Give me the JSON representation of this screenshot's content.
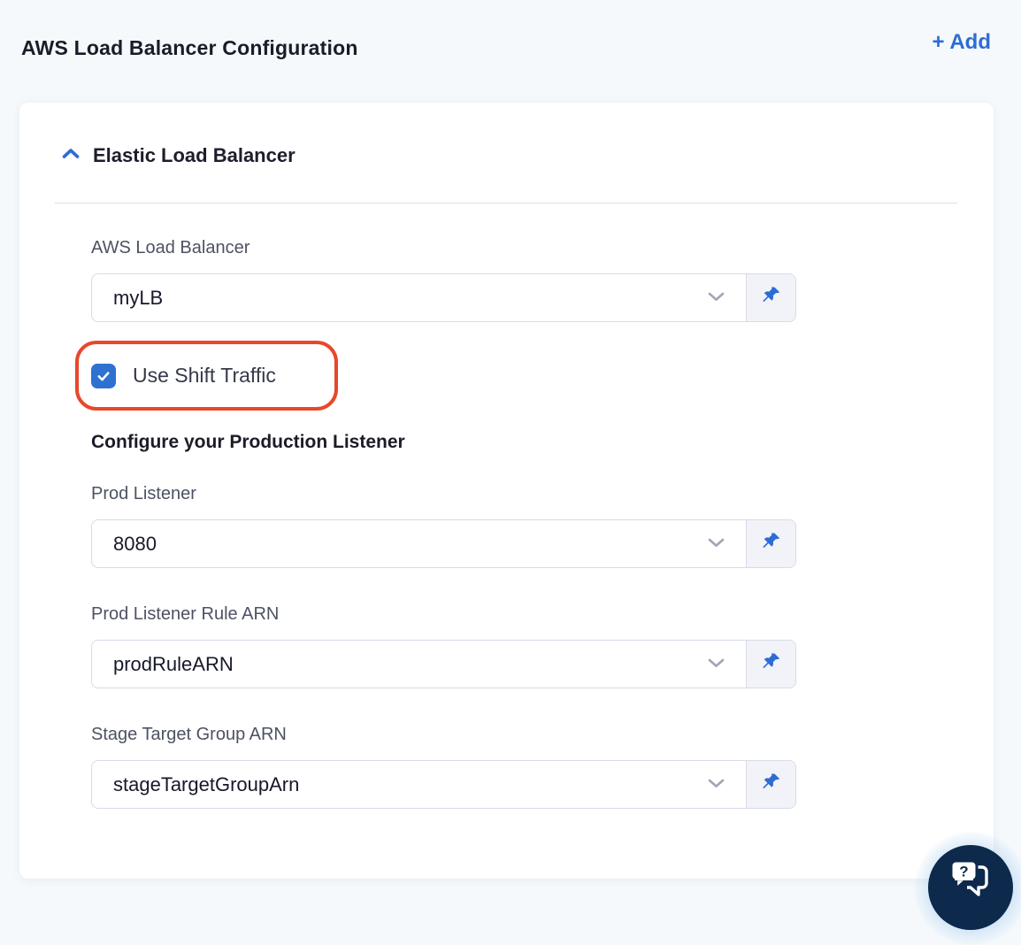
{
  "page": {
    "title": "AWS Load Balancer Configuration",
    "add_label": "+ Add"
  },
  "panel": {
    "section_title": "Elastic Load Balancer",
    "collapsed": false
  },
  "form": {
    "subheading": "Configure your Production Listener",
    "checkbox": {
      "label": "Use Shift Traffic",
      "checked": true
    },
    "fields": [
      {
        "label": "AWS Load Balancer",
        "value": "myLB"
      },
      {
        "label": "Prod Listener",
        "value": "8080"
      },
      {
        "label": "Prod Listener Rule ARN",
        "value": "prodRuleARN"
      },
      {
        "label": "Stage Target Group ARN",
        "value": "stageTargetGroupArn"
      }
    ]
  },
  "icons": {
    "collapse": "chevron-up-icon",
    "dropdown": "chevron-down-icon",
    "pin": "pushpin-icon",
    "help": "chat-question-icon"
  },
  "colors": {
    "accent_blue": "#2e6cd5",
    "checkbox_blue": "#2e71d0",
    "annotation_red": "#e8472b",
    "fab_navy": "#0d2a4d",
    "page_background": "#f5f9fc",
    "label_gray": "#4d5263",
    "border_gray": "#d8dae6"
  }
}
